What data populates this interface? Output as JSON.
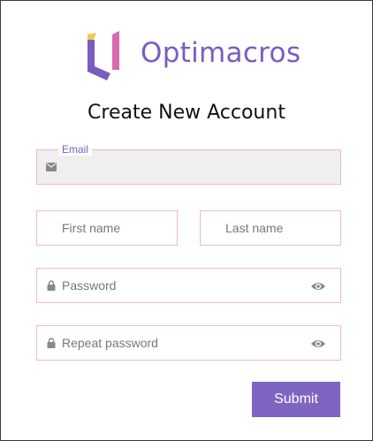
{
  "brand": {
    "name": "Optimacros",
    "logo_icon": "optimacros-logo-icon",
    "colors": {
      "primary": "#7a5cc0",
      "accent_pink": "#d66bb2",
      "accent_yellow": "#f0c84c"
    }
  },
  "form": {
    "title": "Create New Account",
    "email": {
      "label": "Email",
      "value": "",
      "icon": "mail-icon"
    },
    "first_name": {
      "placeholder": "First name"
    },
    "last_name": {
      "placeholder": "Last name"
    },
    "password": {
      "placeholder": "Password",
      "icon": "lock-icon",
      "toggle_icon": "eye-icon"
    },
    "repeat_password": {
      "placeholder": "Repeat password",
      "icon": "lock-icon",
      "toggle_icon": "eye-icon"
    },
    "submit_label": "Submit"
  }
}
